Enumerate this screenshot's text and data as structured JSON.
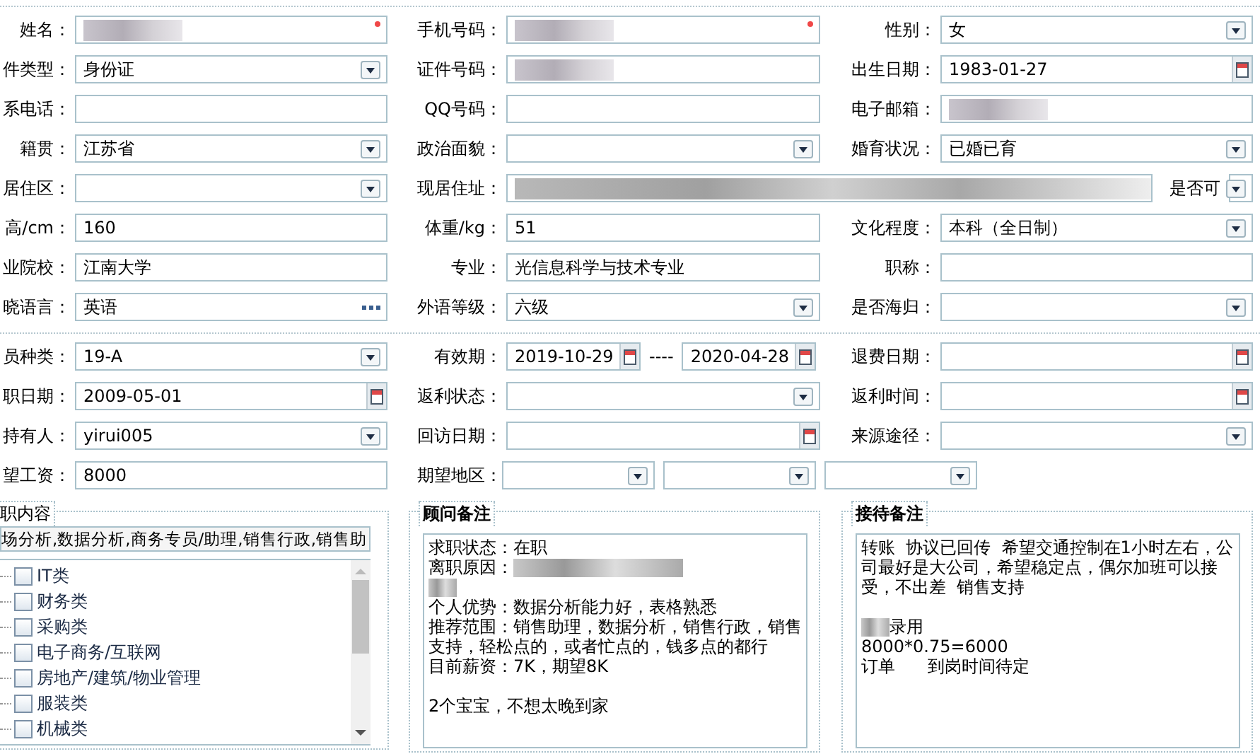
{
  "sections": [
    {
      "rows": [
        {
          "fields": [
            {
              "label": "姓名：",
              "kind": "text",
              "redacted": true,
              "required": true
            },
            {
              "label": "手机号码：",
              "kind": "text",
              "redacted": true,
              "required": true
            },
            {
              "label": "性别：",
              "kind": "select",
              "value": "女"
            }
          ]
        },
        {
          "fields": [
            {
              "label": "件类型：",
              "kind": "select",
              "value": "身份证"
            },
            {
              "label": "证件号码：",
              "kind": "text",
              "redacted": true
            },
            {
              "label": "出生日期：",
              "kind": "date",
              "value": "1983-01-27"
            }
          ]
        },
        {
          "fields": [
            {
              "label": "系电话：",
              "kind": "text"
            },
            {
              "label": "QQ号码：",
              "kind": "text"
            },
            {
              "label": "电子邮箱：",
              "kind": "text",
              "redacted": true
            }
          ]
        },
        {
          "fields": [
            {
              "label": "籍贯：",
              "kind": "select",
              "value": "江苏省"
            },
            {
              "label": "政治面貌：",
              "kind": "select"
            },
            {
              "label": "婚育状况：",
              "kind": "select",
              "value": "已婚已育"
            }
          ]
        },
        {
          "fields": [
            {
              "label": "居住区：",
              "kind": "select"
            },
            {
              "label": "现居住址：",
              "kind": "text",
              "redacted": true,
              "attached": {
                "label": "是否可",
                "kind": "select"
              }
            }
          ]
        },
        {
          "fields": [
            {
              "label": "高/cm：",
              "kind": "text",
              "value": "160"
            },
            {
              "label": "体重/kg：",
              "kind": "text",
              "value": "51"
            },
            {
              "label": "文化程度：",
              "kind": "select",
              "value": "本科（全日制）"
            }
          ]
        },
        {
          "fields": [
            {
              "label": "业院校：",
              "kind": "text",
              "value": "江南大学"
            },
            {
              "label": "专业：",
              "kind": "text",
              "value": "光信息科学与技术专业"
            },
            {
              "label": "职称：",
              "kind": "text"
            }
          ]
        },
        {
          "fields": [
            {
              "label": "晓语言：",
              "kind": "lookup",
              "value": "英语"
            },
            {
              "label": "外语等级：",
              "kind": "select",
              "value": "六级"
            },
            {
              "label": "是否海归：",
              "kind": "select"
            }
          ]
        }
      ]
    },
    {
      "rows": [
        {
          "fields": [
            {
              "label": "员种类：",
              "kind": "select",
              "value": "19-A"
            },
            {
              "label": "有效期：",
              "kind": "date_range",
              "values": [
                "2019-10-29",
                "2020-04-28"
              ],
              "separator": "----"
            },
            {
              "label": "退费日期：",
              "kind": "date"
            }
          ]
        },
        {
          "fields": [
            {
              "label": "职日期：",
              "kind": "date",
              "value": "2009-05-01"
            },
            {
              "label": "返利状态：",
              "kind": "select"
            },
            {
              "label": "返利时间：",
              "kind": "date"
            }
          ]
        },
        {
          "fields": [
            {
              "label": "持有人：",
              "kind": "select",
              "value": "yirui005"
            },
            {
              "label": "回访日期：",
              "kind": "date"
            },
            {
              "label": "来源途径：",
              "kind": "select"
            }
          ]
        },
        {
          "fields": [
            {
              "label": "望工资：",
              "kind": "text",
              "value": "8000"
            },
            {
              "label": "期望地区：",
              "kind": "multi_select",
              "selects": [
                {
                  "kind": "select"
                },
                {
                  "kind": "select"
                },
                {
                  "kind": "select"
                }
              ]
            }
          ]
        }
      ]
    }
  ],
  "job_group": {
    "title": "职内容",
    "value": "场分析,数据分析,商务专员/助理,销售行政,销售助",
    "categories": [
      {
        "label": "IT类",
        "checked": false
      },
      {
        "label": "财务类",
        "checked": false
      },
      {
        "label": "采购类",
        "checked": false
      },
      {
        "label": "电子商务/互联网",
        "checked": false
      },
      {
        "label": "房地产/建筑/物业管理",
        "checked": false
      },
      {
        "label": "服装类",
        "checked": false
      },
      {
        "label": "机械类",
        "checked": false
      }
    ]
  },
  "notes": [
    {
      "title": "顾问备注",
      "lines": [
        {
          "kind": "text",
          "segments": [
            {
              "kind": "text",
              "text": "求职状态：在职"
            }
          ]
        },
        {
          "kind": "text",
          "segments": [
            {
              "kind": "text",
              "text": "离职原因："
            },
            {
              "kind": "redacted"
            }
          ]
        },
        {
          "kind": "text",
          "segments": [
            {
              "kind": "redacted"
            }
          ]
        },
        {
          "kind": "text",
          "segments": [
            {
              "kind": "text",
              "text": "个人优势：数据分析能力好，表格熟悉"
            }
          ]
        },
        {
          "kind": "text",
          "segments": [
            {
              "kind": "text",
              "text": "推荐范围：销售助理，数据分析，销售行政，销售支持，轻松点的，或者忙点的，钱多点的都行"
            }
          ]
        },
        {
          "kind": "text",
          "segments": [
            {
              "kind": "text",
              "text": "目前薪资：7K，期望8K"
            }
          ]
        },
        {
          "kind": "gap"
        },
        {
          "kind": "text",
          "segments": [
            {
              "kind": "text",
              "text": "2个宝宝，不想太晚到家"
            }
          ]
        }
      ]
    },
    {
      "title": "接待备注",
      "lines": [
        {
          "kind": "text",
          "segments": [
            {
              "kind": "text",
              "text": "转账  协议已回传  希望交通控制在1小时左右，公司最好是大公司，希望稳定点，偶尔加班可以接受，不出差  销售支持"
            }
          ]
        },
        {
          "kind": "gap"
        },
        {
          "kind": "text",
          "segments": [
            {
              "kind": "redacted"
            },
            {
              "kind": "text",
              "text": "录用"
            }
          ]
        },
        {
          "kind": "text",
          "segments": [
            {
              "kind": "text",
              "text": "8000*0.75=6000"
            }
          ]
        },
        {
          "kind": "text",
          "segments": [
            {
              "kind": "text",
              "text": "订单      到岗时间待定"
            }
          ]
        }
      ]
    }
  ]
}
